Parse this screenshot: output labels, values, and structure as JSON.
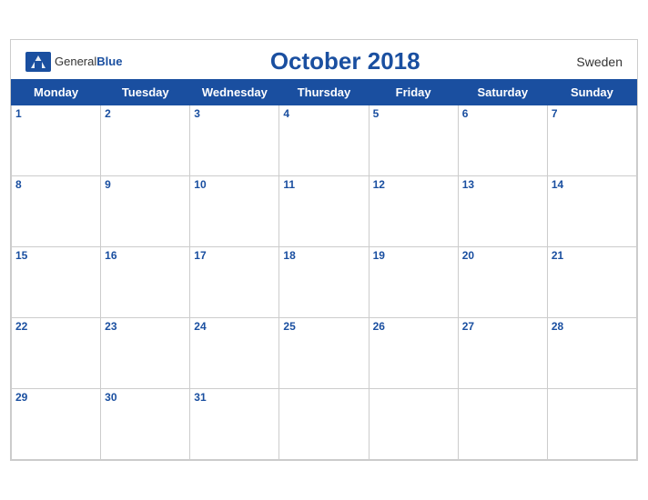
{
  "header": {
    "logo_general": "General",
    "logo_blue": "Blue",
    "month_title": "October 2018",
    "country": "Sweden"
  },
  "weekdays": [
    "Monday",
    "Tuesday",
    "Wednesday",
    "Thursday",
    "Friday",
    "Saturday",
    "Sunday"
  ],
  "weeks": [
    [
      1,
      2,
      3,
      4,
      5,
      6,
      7
    ],
    [
      8,
      9,
      10,
      11,
      12,
      13,
      14
    ],
    [
      15,
      16,
      17,
      18,
      19,
      20,
      21
    ],
    [
      22,
      23,
      24,
      25,
      26,
      27,
      28
    ],
    [
      29,
      30,
      31,
      null,
      null,
      null,
      null
    ]
  ]
}
